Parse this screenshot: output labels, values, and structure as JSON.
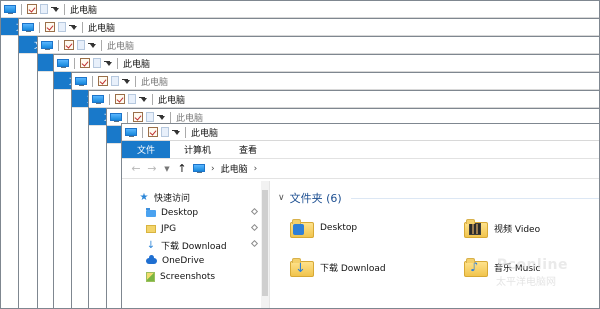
{
  "window": {
    "title": "此电脑"
  },
  "ribbon": {
    "file": "文件",
    "computer": "计算机",
    "view": "查看"
  },
  "address": {
    "back": "←",
    "forward": "→",
    "dropdown": "▼",
    "up": "↑",
    "path_separator": "›",
    "crumbs": [
      "此电脑"
    ]
  },
  "sidebar": {
    "quick_access": "快速访问",
    "items": [
      {
        "label": "Desktop",
        "icon": "desktop-folder-icon",
        "pinned": true
      },
      {
        "label": "JPG",
        "icon": "folder-icon",
        "pinned": true
      },
      {
        "label": "下载 Download",
        "icon": "download-icon",
        "pinned": true
      },
      {
        "label": "OneDrive",
        "icon": "onedrive-icon",
        "pinned": false
      },
      {
        "label": "Screenshots",
        "icon": "screenshots-icon",
        "pinned": false
      }
    ]
  },
  "main": {
    "section_title": "文件夹 (6)",
    "folders": [
      {
        "label": "Desktop",
        "icon": "desktop-folder-icon"
      },
      {
        "label": "视频 Video",
        "icon": "video-folder-icon"
      },
      {
        "label": "下载 Download",
        "icon": "download-folder-icon"
      },
      {
        "label": "音乐 Music",
        "icon": "music-folder-icon"
      }
    ]
  },
  "watermark": {
    "brand": "Pconline",
    "sub": "太平洋电脑网"
  },
  "colors": {
    "accent": "#1979ca",
    "folder_yellow": "#f3d46a",
    "folder_blue": "#2f7fd7"
  }
}
